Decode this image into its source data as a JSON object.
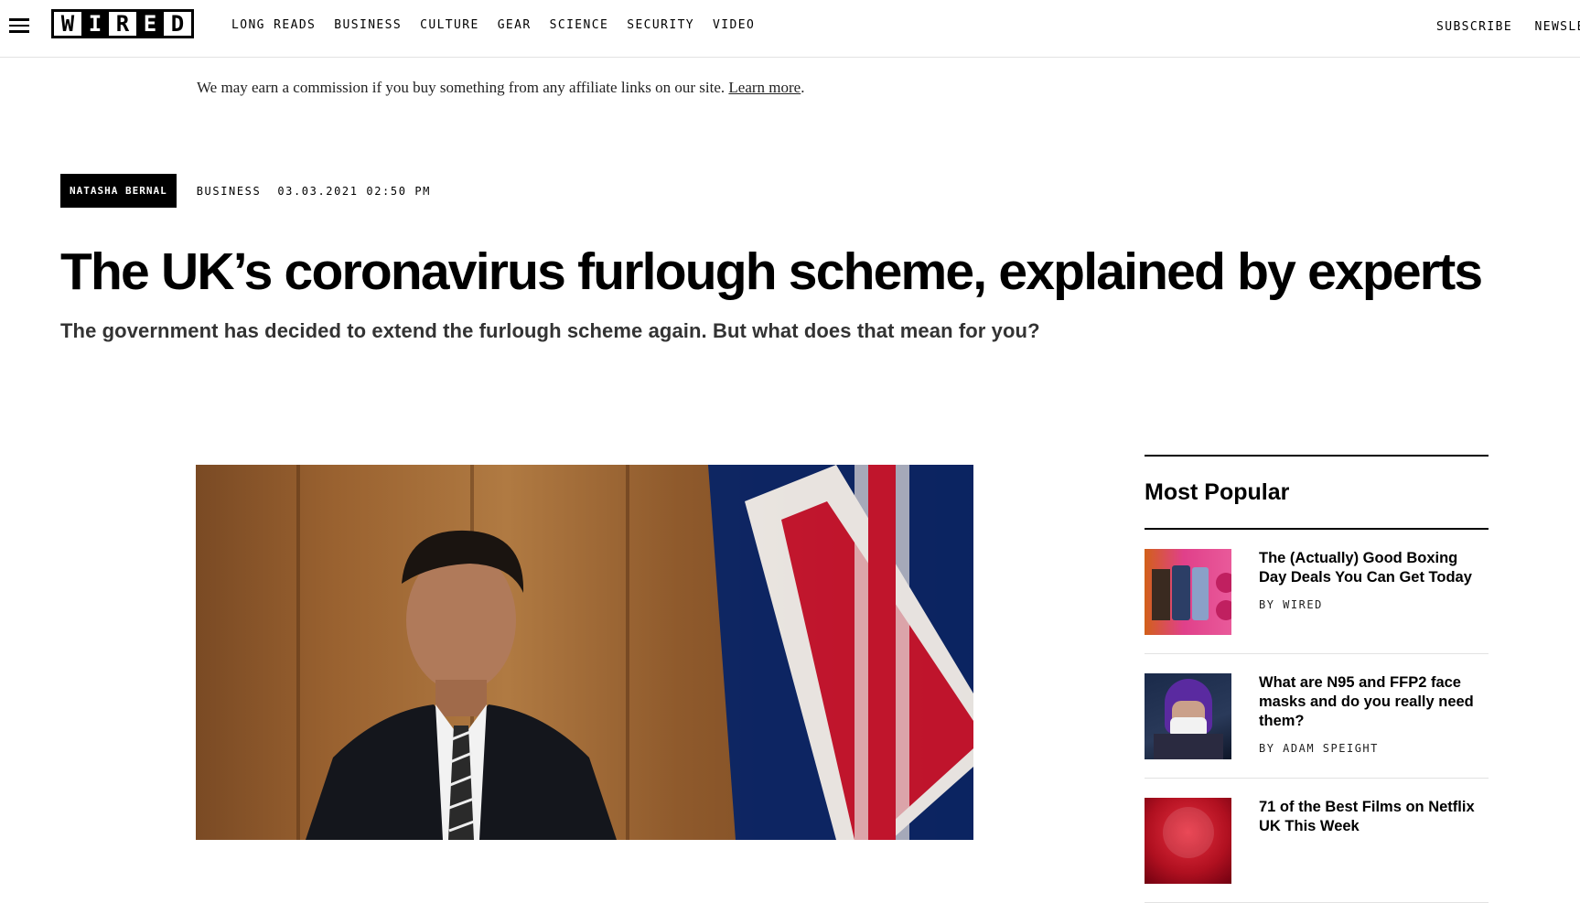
{
  "header": {
    "logo_letters": [
      "W",
      "I",
      "R",
      "E",
      "D"
    ],
    "nav": [
      "LONG READS",
      "BUSINESS",
      "CULTURE",
      "GEAR",
      "SCIENCE",
      "SECURITY",
      "VIDEO"
    ],
    "right": [
      "SUBSCRIBE",
      "NEWSLE"
    ]
  },
  "affiliate": {
    "text": "We may earn a commission if you buy something from any affiliate links on our site. ",
    "link": "Learn more",
    "end": "."
  },
  "article": {
    "author": "NATASHA BERNAL",
    "rubric": "BUSINESS",
    "date": "03.03.2021 02:50 PM",
    "headline": "The UK’s coronavirus furlough scheme, explained by experts",
    "dek": "The government has decided to extend the furlough scheme again. But what does that mean for you?"
  },
  "sidebar": {
    "title": "Most Popular",
    "items": [
      {
        "title": "The (Actually) Good Boxing Day Deals You Can Get Today",
        "byline": "BY WIRED"
      },
      {
        "title": "What are N95 and FFP2 face masks and do you really need them?",
        "byline": "BY ADAM SPEIGHT"
      },
      {
        "title": "71 of the Best Films on Netflix UK This Week",
        "byline": ""
      }
    ]
  },
  "colors": {
    "ink": "#000000",
    "hero_wood": "#9a6230",
    "flag_red": "#c8102e",
    "flag_blue": "#012169"
  }
}
